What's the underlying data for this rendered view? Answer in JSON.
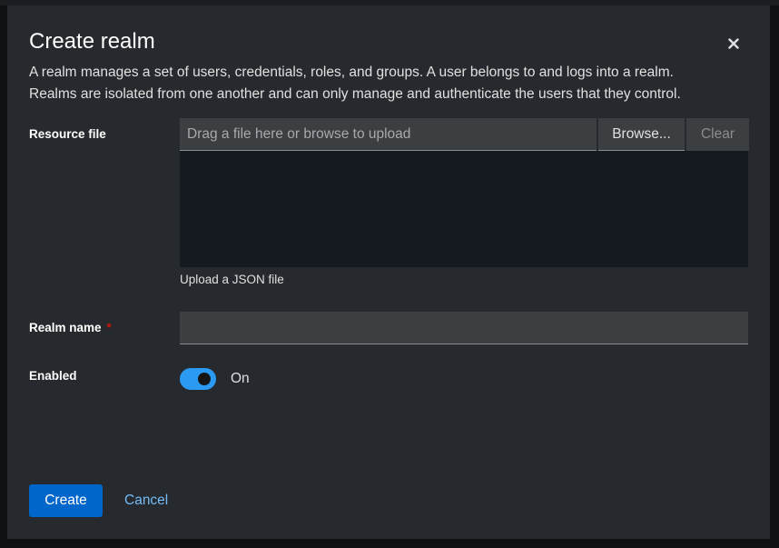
{
  "modal": {
    "title": "Create realm",
    "close_icon": "close-icon",
    "description_line1": "A realm manages a set of users, credentials, roles, and groups. A user belongs to and logs into a realm.",
    "description_line2": "Realms are isolated from one another and can only manage and authenticate the users that they control."
  },
  "resource_file": {
    "label": "Resource file",
    "placeholder": "Drag a file here or browse to upload",
    "browse_label": "Browse...",
    "clear_label": "Clear",
    "contents": "",
    "helper_text": "Upload a JSON file"
  },
  "realm_name": {
    "label": "Realm name",
    "required_marker": "*",
    "value": ""
  },
  "enabled": {
    "label": "Enabled",
    "state_label": "On",
    "checked": true
  },
  "footer": {
    "create_label": "Create",
    "cancel_label": "Cancel"
  },
  "colors": {
    "primary": "#0066cc",
    "link": "#73bcf7",
    "switch_on": "#2b9af3",
    "required": "#c9190b",
    "modal_bg": "#26292d"
  }
}
